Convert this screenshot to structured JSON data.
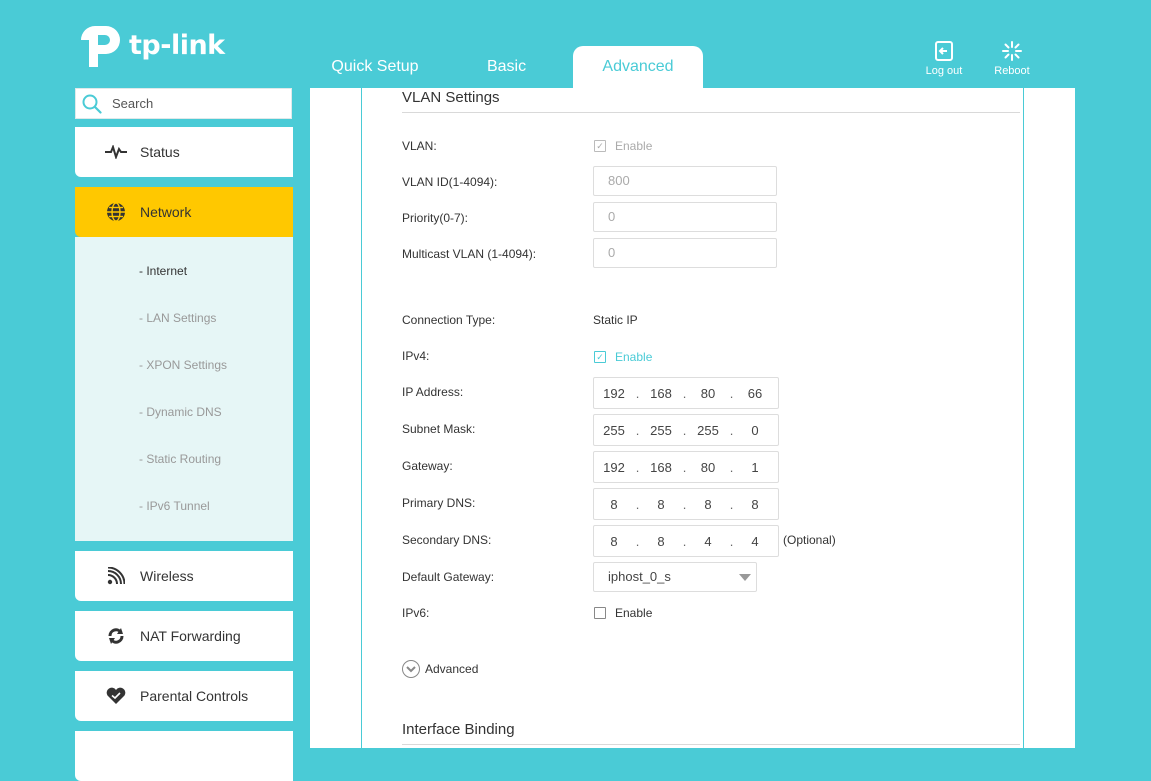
{
  "brand": {
    "name": "tp-link"
  },
  "tabs": [
    {
      "label": "Quick Setup"
    },
    {
      "label": "Basic"
    },
    {
      "label": "Advanced"
    }
  ],
  "header_buttons": {
    "logout": "Log out",
    "reboot": "Reboot"
  },
  "search": {
    "placeholder": "Search"
  },
  "nav": {
    "status": "Status",
    "network": "Network",
    "wireless": "Wireless",
    "nat": "NAT Forwarding",
    "parental": "Parental Controls"
  },
  "subnav": [
    "- Internet",
    "- LAN Settings",
    "- XPON Settings",
    "- Dynamic DNS",
    "- Static Routing",
    "- IPv6 Tunnel"
  ],
  "vlan": {
    "title": "VLAN Settings",
    "vlan_label": "VLAN:",
    "vlan_enable": "Enable",
    "vlan_id_label": "VLAN ID(1-4094):",
    "vlan_id_value": "800",
    "priority_label": "Priority(0-7):",
    "priority_value": "0",
    "multicast_label": "Multicast VLAN (1-4094):",
    "multicast_value": "0"
  },
  "conn": {
    "type_label": "Connection Type:",
    "type_value": "Static IP",
    "ipv4_label": "IPv4:",
    "ipv4_enable": "Enable",
    "ip_label": "IP Address:",
    "ip": [
      "192",
      "168",
      "80",
      "66"
    ],
    "mask_label": "Subnet Mask:",
    "mask": [
      "255",
      "255",
      "255",
      "0"
    ],
    "gw_label": "Gateway:",
    "gw": [
      "192",
      "168",
      "80",
      "1"
    ],
    "dns1_label": "Primary DNS:",
    "dns1": [
      "8",
      "8",
      "8",
      "8"
    ],
    "dns2_label": "Secondary DNS:",
    "dns2": [
      "8",
      "8",
      "4",
      "4"
    ],
    "optional": "(Optional)",
    "default_gw_label": "Default Gateway:",
    "default_gw_value": "iphost_0_s",
    "ipv6_label": "IPv6:",
    "ipv6_enable": "Enable",
    "advanced": "Advanced"
  },
  "binding": {
    "title": "Interface Binding"
  },
  "colors": {
    "teal": "#4acbd6",
    "active_nav": "#ffc800",
    "subnav_bg": "#e6f6f6"
  }
}
